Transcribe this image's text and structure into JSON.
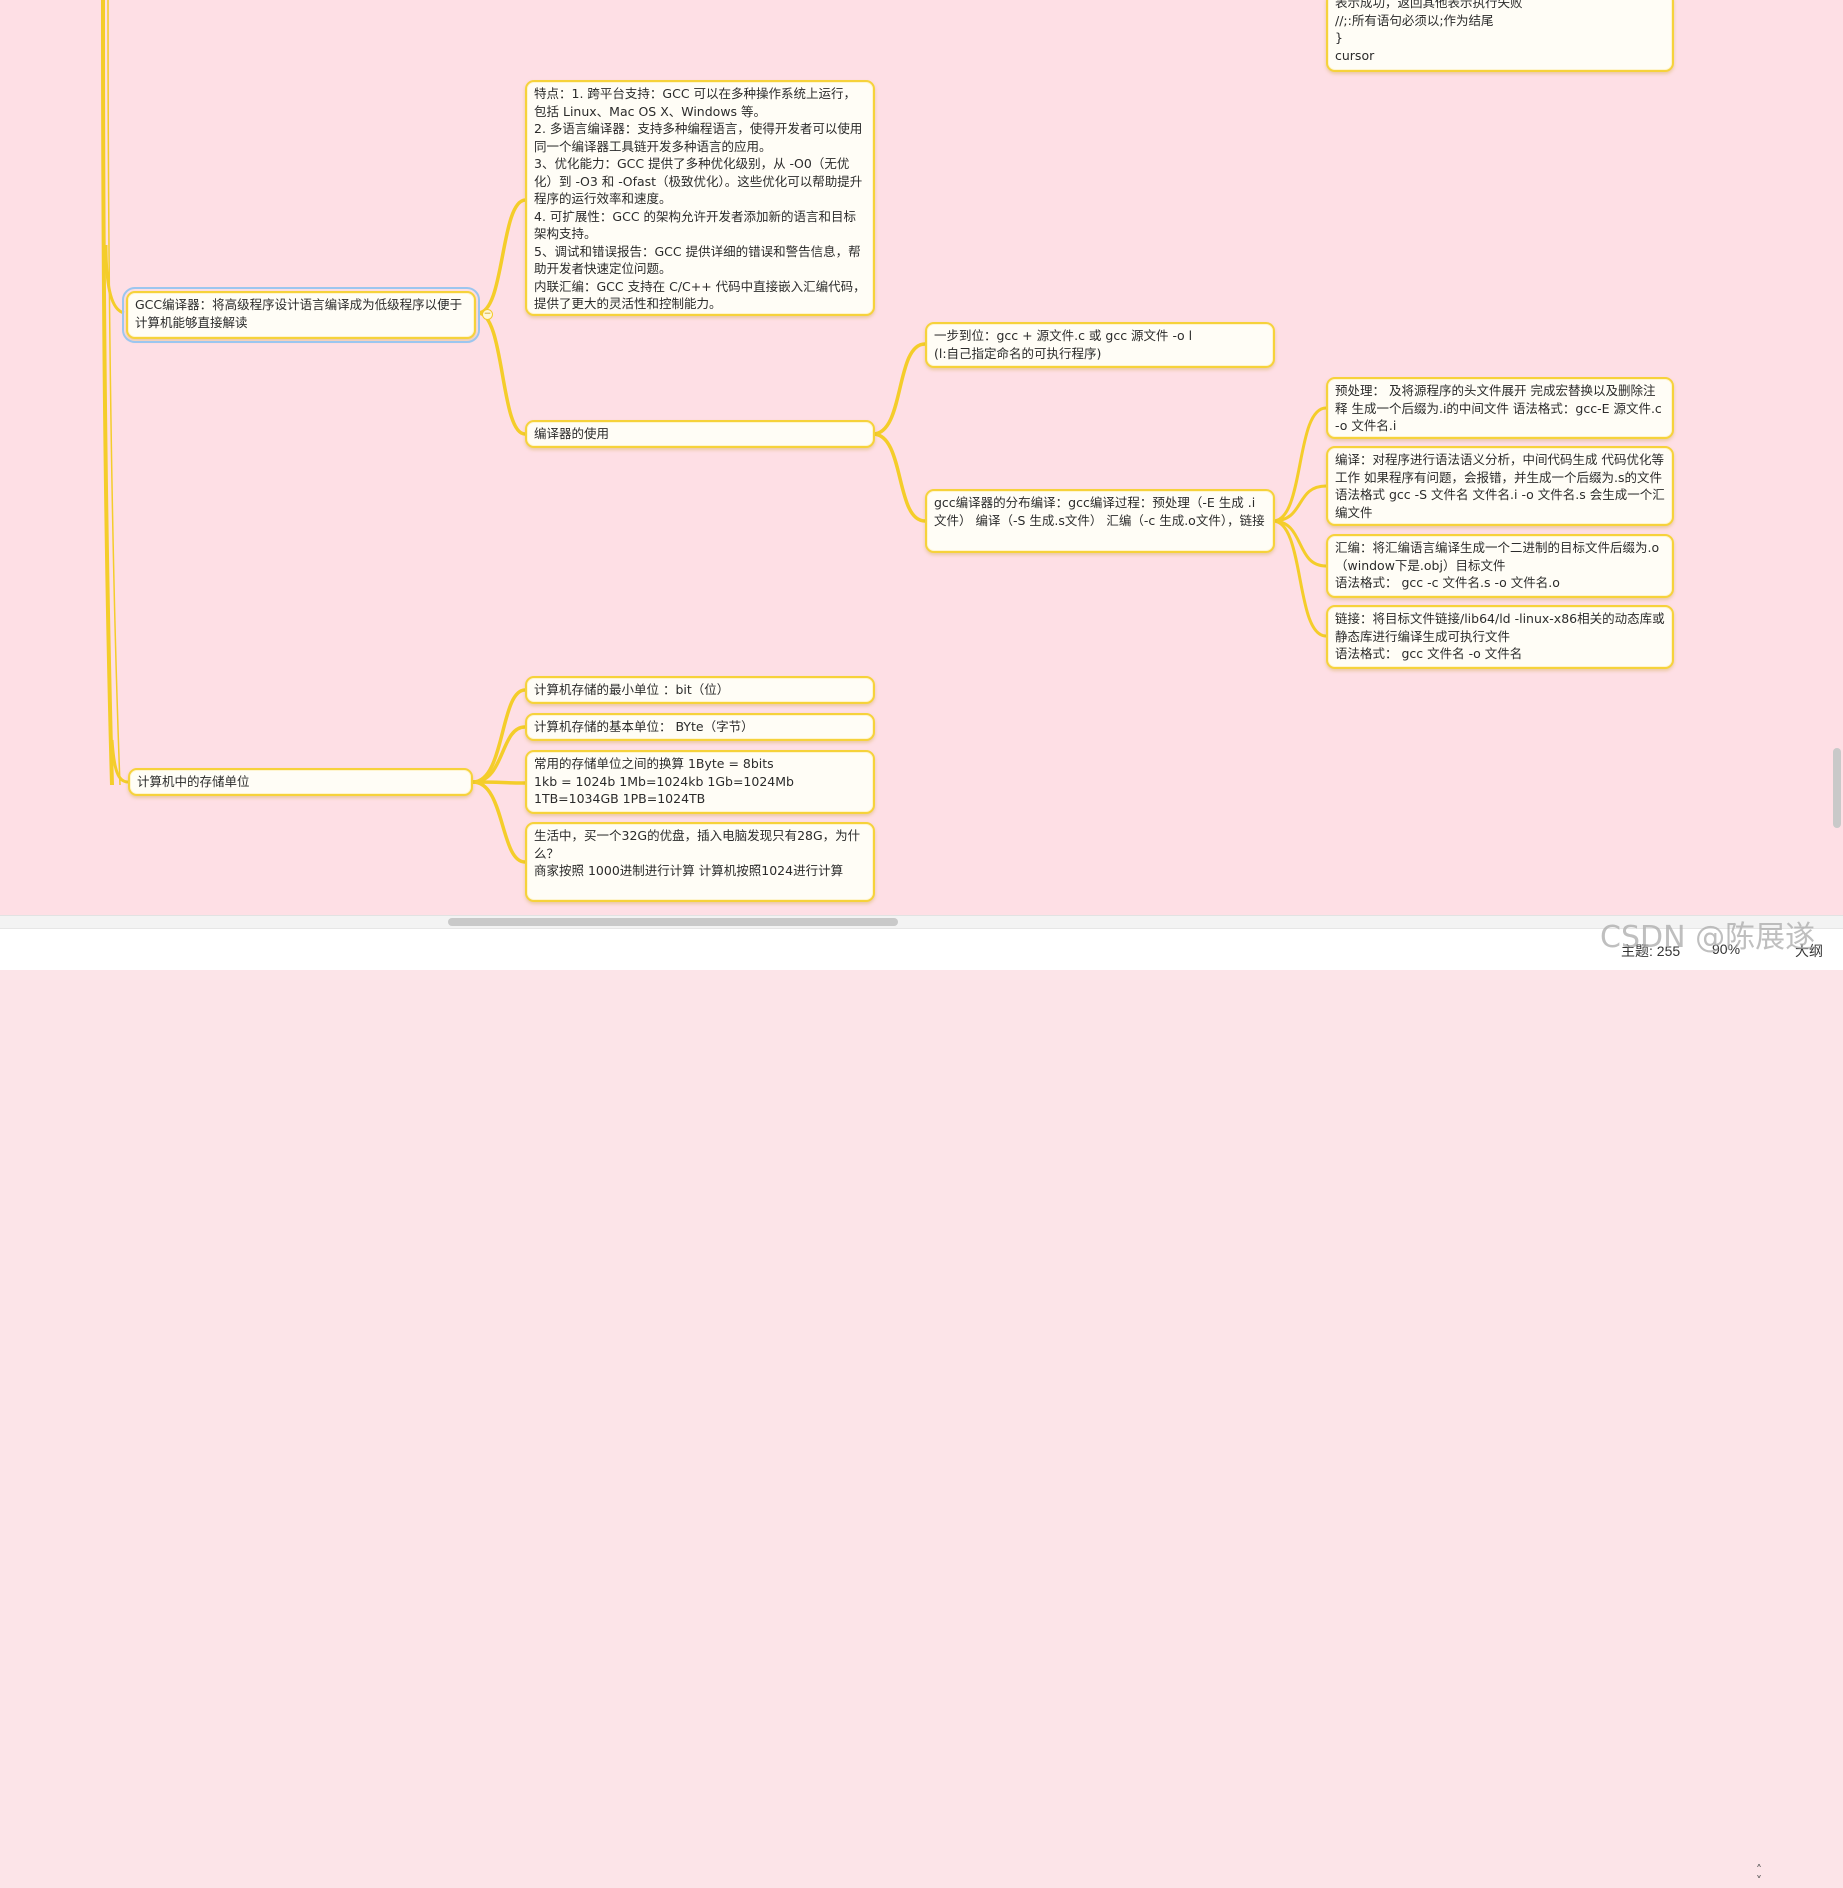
{
  "nodes": {
    "cursor_code": "表示成功，返回其他表示执行失败\n //;:所有语句必须以;作为结尾\n}\n cursor",
    "gcc_features": "特点：1. 跨平台支持：GCC 可以在多种操作系统上运行，包括 Linux、Mac OS X、Windows 等。\n2. 多语言编译器：支持多种编程语言，使得开发者可以使用同一个编译器工具链开发多种语言的应用。\n3、优化能力：GCC 提供了多种优化级别，从 -O0（无优化）到 -O3 和 -Ofast（极致优化）。这些优化可以帮助提升程序的运行效率和速度。\n4. 可扩展性：GCC 的架构允许开发者添加新的语言和目标架构支持。\n5、调试和错误报告：GCC 提供详细的错误和警告信息，帮助开发者快速定位问题。\n内联汇编：GCC 支持在 C/C++ 代码中直接嵌入汇编代码，提供了更大的灵活性和控制能力。",
    "gcc_compiler": "GCC编译器：将高级程序设计语言编译成为低级程序以便于计算机能够直接解读",
    "one_step": "一步到位：gcc + 源文件.c    或 gcc 源文件 -o  l\n(l:自己指定命名的可执行程序)",
    "preprocess": "预处理： 及将源程序的头文件展开 完成宏替换以及删除注释 生成一个后缀为.i的中间文件 语法格式：gcc-E 源文件.c -o 文件名.i",
    "compiler_usage": "编译器的使用",
    "compile": "编译：对程序进行语法语义分析，中间代码生成 代码优化等工作 如果程序有问题，会报错，并生成一个后缀为.s的文件 语法格式 gcc -S  文件名 文件名.i   -o 文件名.s  会生成一个汇编文件",
    "gcc_steps": "gcc编译器的分布编译：gcc编译过程：预处理（-E 生成 .i 文件） 编译（-S 生成.s文件） 汇编（-c 生成.o文件），链接",
    "assemble": "汇编：将汇编语言编译生成一个二进制的目标文件后缀为.o（window下是.obj）目标文件\n 语法格式： gcc -c 文件名.s -o 文件名.o",
    "link": "链接：将目标文件链接/lib64/ld -linux-x86相关的动态库或静态库进行编译生成可执行文件\n 语法格式： gcc 文件名 -o 文件名",
    "min_unit": "计算机存储的最小单位 ：bit（位）",
    "basic_unit": "计算机存储的基本单位： BYte（字节）",
    "storage_root": "计算机中的存储单位",
    "conversions": "常用的存储单位之间的换算      1Byte = 8bits\n      1kb = 1024b 1Mb=1024kb  1Gb=1024Mb\n      1TB=1034GB   1PB=1024TB",
    "real_life": "生活中，买一个32G的优盘，插入电脑发现只有28G，为什么？\n 商家按照 1000进制进行计算    计算机按照1024进行计算"
  },
  "status": {
    "topics": "主题: 255",
    "zoom": "90%",
    "size": "大纲"
  },
  "watermark": "CSDN @陈展遂",
  "colors": {
    "background": "#fedfe5",
    "node_border": "#f6d23b",
    "link": "#f4cd2a",
    "selection": "#9cc6ef"
  }
}
